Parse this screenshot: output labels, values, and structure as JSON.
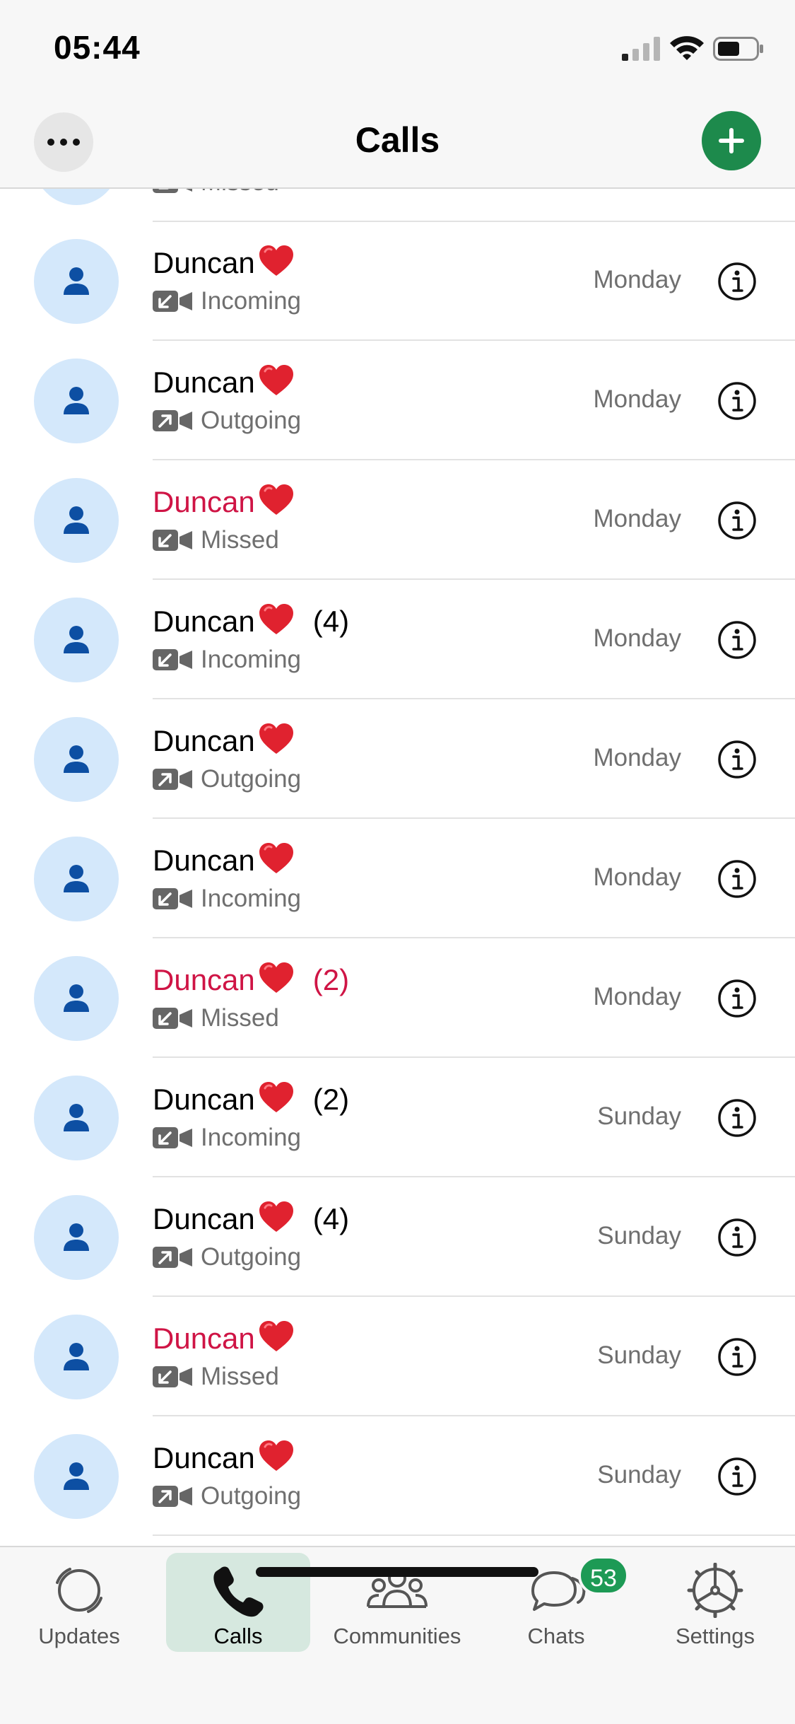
{
  "status_bar": {
    "time": "05:44"
  },
  "header": {
    "title": "Calls"
  },
  "partial_row": {
    "type": "Missed"
  },
  "calls": [
    {
      "name": "Duncan",
      "count": "",
      "type": "Incoming",
      "direction": "incoming",
      "day": "Monday",
      "missed": false
    },
    {
      "name": "Duncan",
      "count": "",
      "type": "Outgoing",
      "direction": "outgoing",
      "day": "Monday",
      "missed": false
    },
    {
      "name": "Duncan",
      "count": "",
      "type": "Missed",
      "direction": "incoming",
      "day": "Monday",
      "missed": true
    },
    {
      "name": "Duncan",
      "count": "(4)",
      "type": "Incoming",
      "direction": "incoming",
      "day": "Monday",
      "missed": false
    },
    {
      "name": "Duncan",
      "count": "",
      "type": "Outgoing",
      "direction": "outgoing",
      "day": "Monday",
      "missed": false
    },
    {
      "name": "Duncan",
      "count": "",
      "type": "Incoming",
      "direction": "incoming",
      "day": "Monday",
      "missed": false
    },
    {
      "name": "Duncan",
      "count": "(2)",
      "type": "Missed",
      "direction": "incoming",
      "day": "Monday",
      "missed": true
    },
    {
      "name": "Duncan",
      "count": "(2)",
      "type": "Incoming",
      "direction": "incoming",
      "day": "Sunday",
      "missed": false
    },
    {
      "name": "Duncan",
      "count": "(4)",
      "type": "Outgoing",
      "direction": "outgoing",
      "day": "Sunday",
      "missed": false
    },
    {
      "name": "Duncan",
      "count": "",
      "type": "Missed",
      "direction": "incoming",
      "day": "Sunday",
      "missed": true
    },
    {
      "name": "Duncan",
      "count": "",
      "type": "Outgoing",
      "direction": "outgoing",
      "day": "Sunday",
      "missed": false
    }
  ],
  "tabs": [
    {
      "label": "Updates",
      "icon": "updates-icon",
      "active": false
    },
    {
      "label": "Calls",
      "icon": "phone-icon",
      "active": true
    },
    {
      "label": "Communities",
      "icon": "communities-icon",
      "active": false
    },
    {
      "label": "Chats",
      "icon": "chats-icon",
      "active": false,
      "badge": "53"
    },
    {
      "label": "Settings",
      "icon": "settings-icon",
      "active": false
    }
  ],
  "colors": {
    "accent_green": "#1d8a4c",
    "missed_red": "#cf1445",
    "avatar_bg": "#d4e8fb",
    "avatar_fg": "#0d4fa3"
  }
}
